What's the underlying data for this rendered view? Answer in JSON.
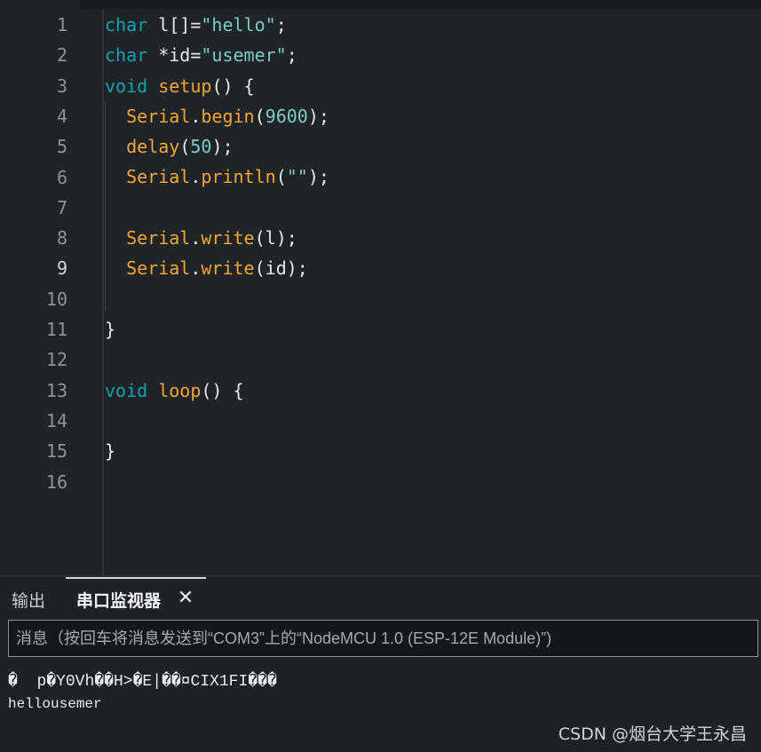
{
  "editor": {
    "line_numbers": [
      "1",
      "2",
      "3",
      "4",
      "5",
      "6",
      "7",
      "8",
      "9",
      "10",
      "11",
      "12",
      "13",
      "14",
      "15",
      "16"
    ],
    "active_line": "9",
    "lines": [
      [
        {
          "t": "char",
          "c": "kw"
        },
        {
          "t": " l[]=",
          "c": "pl"
        },
        {
          "t": "\"hello\"",
          "c": "str"
        },
        {
          "t": ";",
          "c": "pl"
        }
      ],
      [
        {
          "t": "char",
          "c": "kw"
        },
        {
          "t": " *id=",
          "c": "pl"
        },
        {
          "t": "\"usemer\"",
          "c": "str"
        },
        {
          "t": ";",
          "c": "pl"
        }
      ],
      [
        {
          "t": "void",
          "c": "kw"
        },
        {
          "t": " ",
          "c": "pl"
        },
        {
          "t": "setup",
          "c": "fn"
        },
        {
          "t": "() {",
          "c": "pl"
        }
      ],
      [
        {
          "t": "  ",
          "c": "pl"
        },
        {
          "t": "Serial",
          "c": "fn"
        },
        {
          "t": ".",
          "c": "pl"
        },
        {
          "t": "begin",
          "c": "fn"
        },
        {
          "t": "(",
          "c": "pl"
        },
        {
          "t": "9600",
          "c": "num"
        },
        {
          "t": ");",
          "c": "pl"
        }
      ],
      [
        {
          "t": "  ",
          "c": "pl"
        },
        {
          "t": "delay",
          "c": "fn"
        },
        {
          "t": "(",
          "c": "pl"
        },
        {
          "t": "50",
          "c": "num"
        },
        {
          "t": ");",
          "c": "pl"
        }
      ],
      [
        {
          "t": "  ",
          "c": "pl"
        },
        {
          "t": "Serial",
          "c": "fn"
        },
        {
          "t": ".",
          "c": "pl"
        },
        {
          "t": "println",
          "c": "fn"
        },
        {
          "t": "(",
          "c": "pl"
        },
        {
          "t": "\"\"",
          "c": "str"
        },
        {
          "t": ");",
          "c": "pl"
        }
      ],
      [],
      [
        {
          "t": "  ",
          "c": "pl"
        },
        {
          "t": "Serial",
          "c": "fn"
        },
        {
          "t": ".",
          "c": "pl"
        },
        {
          "t": "write",
          "c": "fn"
        },
        {
          "t": "(l);",
          "c": "pl"
        }
      ],
      [
        {
          "t": "  ",
          "c": "pl"
        },
        {
          "t": "Serial",
          "c": "fn"
        },
        {
          "t": ".",
          "c": "pl"
        },
        {
          "t": "write",
          "c": "fn"
        },
        {
          "t": "(id);",
          "c": "pl"
        }
      ],
      [],
      [
        {
          "t": "}",
          "c": "pl"
        }
      ],
      [],
      [
        {
          "t": "void",
          "c": "kw"
        },
        {
          "t": " ",
          "c": "pl"
        },
        {
          "t": "loop",
          "c": "fn"
        },
        {
          "t": "() {",
          "c": "pl"
        }
      ],
      [],
      [
        {
          "t": "}",
          "c": "pl"
        }
      ],
      []
    ]
  },
  "panel": {
    "tabs": [
      {
        "label": "输出",
        "active": false
      },
      {
        "label": "串口监视器",
        "active": true
      }
    ],
    "close_glyph": "✕",
    "message_placeholder": "消息（按回车将消息发送到“COM3”上的“NodeMCU 1.0 (ESP-12E Module)”)",
    "output_lines": [
      "�  p�Y0Vh��H>�E|��¤CIX1FI���",
      "hellousemer"
    ]
  },
  "watermark": "CSDN @烟台大学王永昌",
  "colors": {
    "keyword": "#0fa3b3",
    "function": "#f5a531",
    "string": "#7fcbc4",
    "background": "#1f2428"
  }
}
